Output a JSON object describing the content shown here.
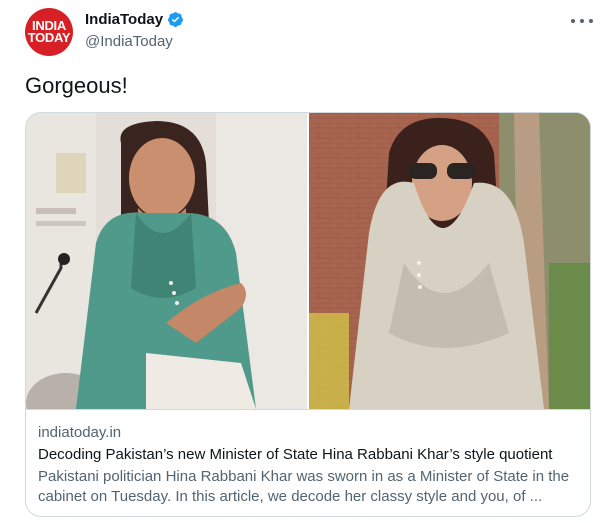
{
  "account": {
    "avatar_line1": "INDIA",
    "avatar_line2": "TODAY",
    "display_name": "IndiaToday",
    "handle": "@IndiaToday",
    "verified": true,
    "verified_color": "#1d9bf0",
    "avatar_color": "#d71f26"
  },
  "tweet": {
    "text": "Gorgeous!"
  },
  "link_card": {
    "images": [
      {
        "icon": "photo-left-woman-teal-outfit"
      },
      {
        "icon": "photo-right-woman-sunglasses-scarf"
      }
    ],
    "domain": "indiatoday.in",
    "headline": "Decoding Pakistan’s new Minister of State Hina Rabbani Khar’s style quotient",
    "description": "Pakistani politician Hina Rabbani Khar was sworn in as a Minister of State in the cabinet on Tuesday. In this article, we decode her classy style and you, of ..."
  },
  "icons": {
    "more": "more-options-icon",
    "verified": "verified-badge-icon"
  }
}
